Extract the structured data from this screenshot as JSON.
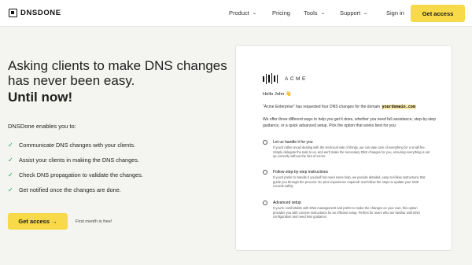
{
  "nav": {
    "logo_text": "DNSDONE",
    "items": [
      {
        "label": "Product",
        "has_dropdown": true
      },
      {
        "label": "Pricing",
        "has_dropdown": false
      },
      {
        "label": "Tools",
        "has_dropdown": true
      },
      {
        "label": "Support",
        "has_dropdown": true
      }
    ],
    "signin_label": "Sign in",
    "cta_label": "Get access",
    "chevron": "⌄"
  },
  "hero": {
    "title": "Asking clients to make DNS changes has never been easy.",
    "title_bold": "Until now!",
    "intro": "DNSDone enables you to:",
    "check_icon": "✓",
    "features": [
      "Communicate DNS changes with your clients.",
      "Assist your clients in making the DNS changes.",
      "Check DNS propagation to validate the changes.",
      "Get notified once the changes are done."
    ],
    "cta_label": "Get access →",
    "cta_note": "First month is free!"
  },
  "email": {
    "brand": "ACME",
    "greeting": "Hello John 👋",
    "request_prefix": "\"Acme Enterprise\" has requested four DNS changes for the domain",
    "domain": "yourdomain.com",
    "offer": "We offer three different ways to help you get it done, whether you need full assistance, step-by-step guidance, or a quick advanced setup. Pick the option that works best for you:",
    "options": [
      {
        "title": "Let us handle it for you",
        "description": "If you'd rather avoid dealing with the technical side of things, we can take care of everything for a small fee. Simply delegate the task to us, and we'll make the necessary DNS changes for you, ensuring everything is set up correctly without the hint of errors."
      },
      {
        "title": "Follow step-by-step instructions",
        "description": "If you'd prefer to handle it yourself but need some help, we provide detailed, easy-to-follow instructions that guide you through the process. No prior experience required! Just follow the steps to update your DNS records safely."
      },
      {
        "title": "Advanced setup",
        "description": "If you're comfortable with DNS management and prefer to make the changes on your own, this option provides you with concise instructions for an efficient setup. Perfect for users who are familiar with DNS configuration and need less guidance."
      }
    ]
  },
  "colors": {
    "accent": "#f7d94a",
    "check": "#1f9d55",
    "background": "#f4f4f1",
    "domain_highlight": "#fbe9a6"
  }
}
